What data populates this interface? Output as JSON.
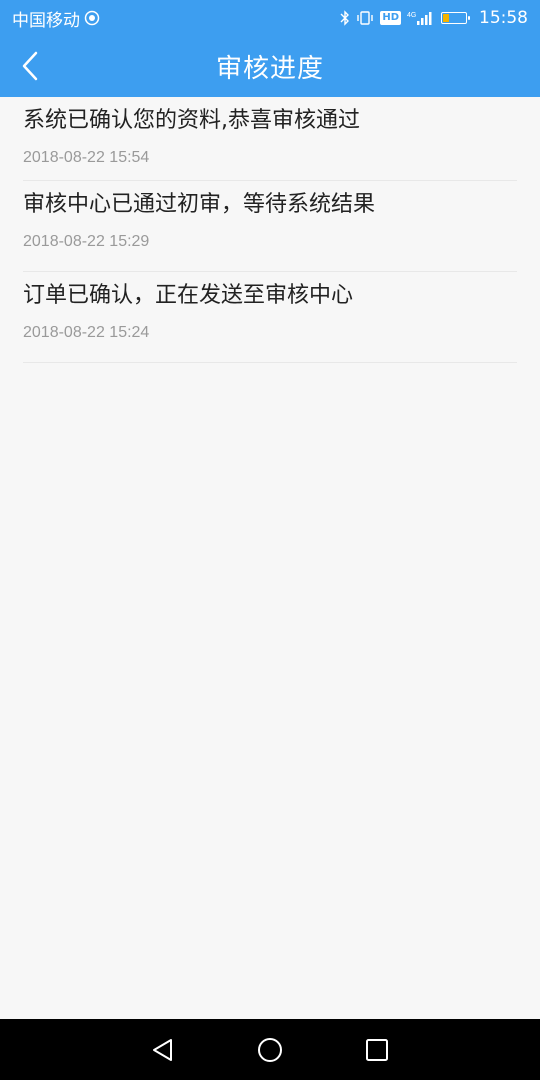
{
  "status_bar": {
    "carrier": "中国移动",
    "hd": "HD",
    "network": "4G",
    "time": "15:58"
  },
  "nav": {
    "title": "审核进度"
  },
  "progress_items": [
    {
      "title": "系统已确认您的资料,恭喜审核通过",
      "time": "2018-08-22 15:54"
    },
    {
      "title": "审核中心已通过初审，等待系统结果",
      "time": "2018-08-22 15:29"
    },
    {
      "title": "订单已确认，正在发送至审核中心",
      "time": "2018-08-22 15:24"
    }
  ],
  "colors": {
    "accent": "#3d9ef0",
    "background": "#f7f7f7",
    "title_text": "#222222",
    "time_text": "#9a9a9a"
  }
}
